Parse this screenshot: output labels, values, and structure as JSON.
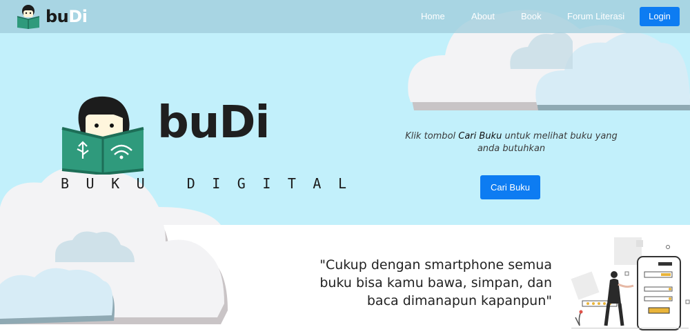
{
  "brand": {
    "name_prefix": "bu",
    "name_suffix": "Di",
    "hero_name": "buDi",
    "tagline": "BUKU DIGITAL"
  },
  "nav": {
    "items": [
      {
        "label": "Home"
      },
      {
        "label": "About"
      },
      {
        "label": "Book"
      },
      {
        "label": "Forum Literasi"
      }
    ],
    "login_label": "Login"
  },
  "hero": {
    "hint_prefix": "Klik tombol ",
    "hint_emphasis": "Cari Buku",
    "hint_suffix": " untuk melihat buku yang anda butuhkan",
    "button_label": "Cari Buku"
  },
  "section2": {
    "quote_line1": "\"Cukup dengan smartphone semua",
    "quote_line2": "buku bisa kamu bawa, simpan, dan",
    "quote_line3": "baca dimanapun kapanpun\""
  },
  "colors": {
    "hero_bg": "#c2f0fb",
    "accent": "#0d7cf2",
    "book_green": "#2f9a7c",
    "cloud": "#f2f2f4",
    "cloud_shadow": "#c9c4c6"
  }
}
